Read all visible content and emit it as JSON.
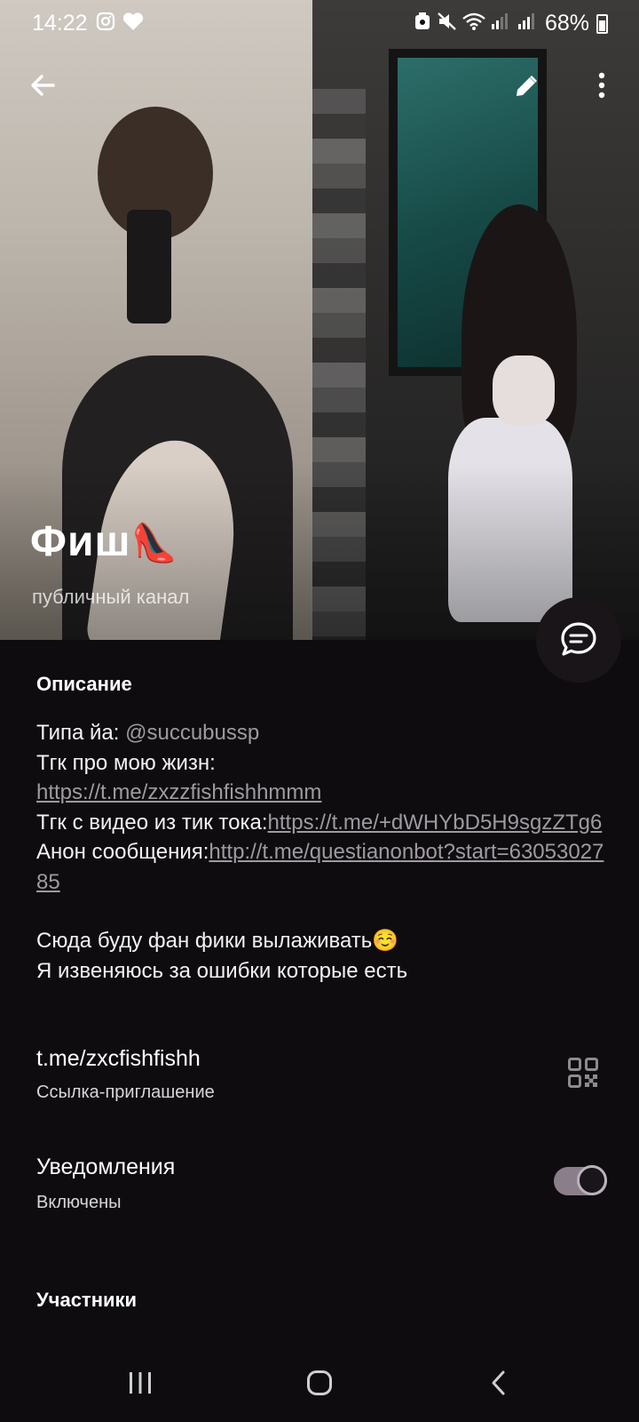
{
  "status_bar": {
    "time": "14:22",
    "battery": "68%"
  },
  "header": {
    "channel_name": "Фиш",
    "channel_emoji": "👠",
    "channel_type": "публичный канал"
  },
  "description": {
    "title": "Описание",
    "line1_label": "Типа йа: ",
    "line1_handle": "@succubussp",
    "line2_label": "Тгк про мою жизн:",
    "line2_link": "https://t.me/zxzzfishfishhmmm",
    "line3_label": "Тгк с видео из тик тока:",
    "line3_link": "https://t.me/+dWHYbD5H9sgzZTg6",
    "line4_label": "Анон сообщения:",
    "line4_link": "http://t.me/questianonbot?start=6305302785",
    "line5": "Сюда буду фан фики вылаживать☺️",
    "line6": "Я извеняюсь за ошибки которые есть"
  },
  "invite": {
    "link": "t.me/zxcfishfishh",
    "label": "Ссылка-приглашение"
  },
  "notifications": {
    "title": "Уведомления",
    "state": "Включены",
    "enabled": true
  },
  "members": {
    "title": "Участники"
  },
  "colors": {
    "background": "#0f0c10",
    "link": "#9e9aa0",
    "toggle_track": "#8a7e8a"
  }
}
